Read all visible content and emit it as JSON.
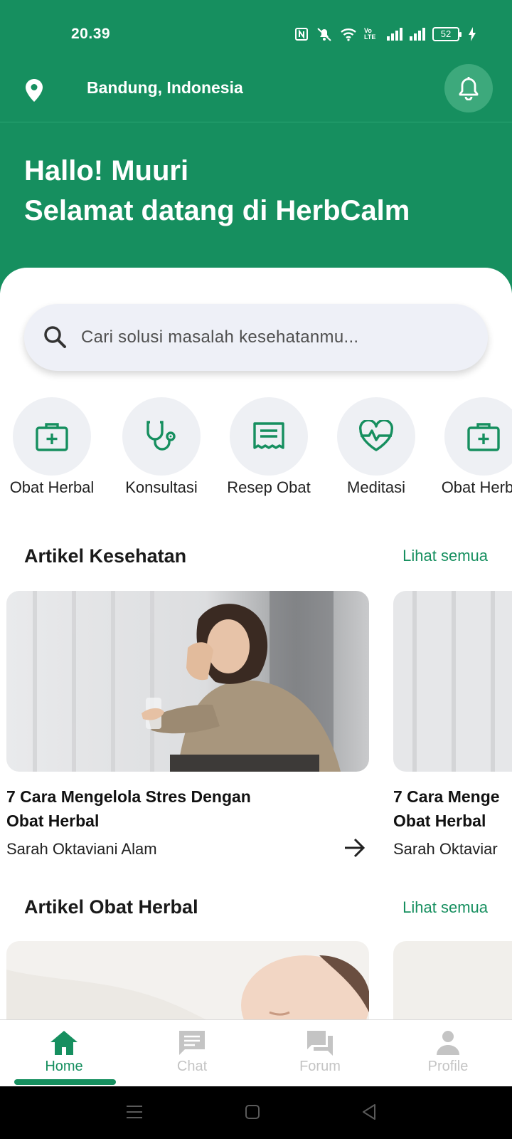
{
  "status_bar": {
    "time": "20.39",
    "battery": "52",
    "lte_label": "Vo LTE"
  },
  "header": {
    "location": "Bandung, Indonesia",
    "location_icon": "map-pin-icon",
    "notification_icon": "bell-icon"
  },
  "hero": {
    "greeting_line1": "Hallo! Muuri",
    "greeting_line2": "Selamat datang di HerbCalm"
  },
  "search": {
    "placeholder": "Cari solusi masalah kesehatanmu...",
    "icon": "search-icon"
  },
  "categories": [
    {
      "label": "Obat Herbal",
      "icon": "medical-kit-icon"
    },
    {
      "label": "Konsultasi",
      "icon": "stethoscope-icon"
    },
    {
      "label": "Resep Obat",
      "icon": "receipt-icon"
    },
    {
      "label": "Meditasi",
      "icon": "heart-pulse-icon"
    },
    {
      "label": "Obat Herbal",
      "icon": "medical-kit-icon"
    }
  ],
  "section_kesehatan": {
    "title": "Artikel Kesehatan",
    "see_all": "Lihat semua",
    "articles": [
      {
        "title": "7 Cara Mengelola Stres Dengan Obat Herbal",
        "title_line1": "7 Cara Mengelola Stres Dengan",
        "title_line2": "Obat Herbal",
        "author": "Sarah Oktaviani Alam"
      },
      {
        "title_line1": "7 Cara Menge",
        "title_line2": "Obat Herbal",
        "author": "Sarah Oktaviar"
      }
    ]
  },
  "section_herbal": {
    "title": "Artikel Obat Herbal",
    "see_all": "Lihat semua"
  },
  "bottom_nav": [
    {
      "label": "Home",
      "icon": "home-icon",
      "active": true
    },
    {
      "label": "Chat",
      "icon": "chat-icon",
      "active": false
    },
    {
      "label": "Forum",
      "icon": "forum-icon",
      "active": false
    },
    {
      "label": "Profile",
      "icon": "profile-icon",
      "active": false
    }
  ],
  "colors": {
    "primary": "#168f5f",
    "search_bg": "#eef0f7",
    "inactive_nav": "#c4c4c4"
  }
}
